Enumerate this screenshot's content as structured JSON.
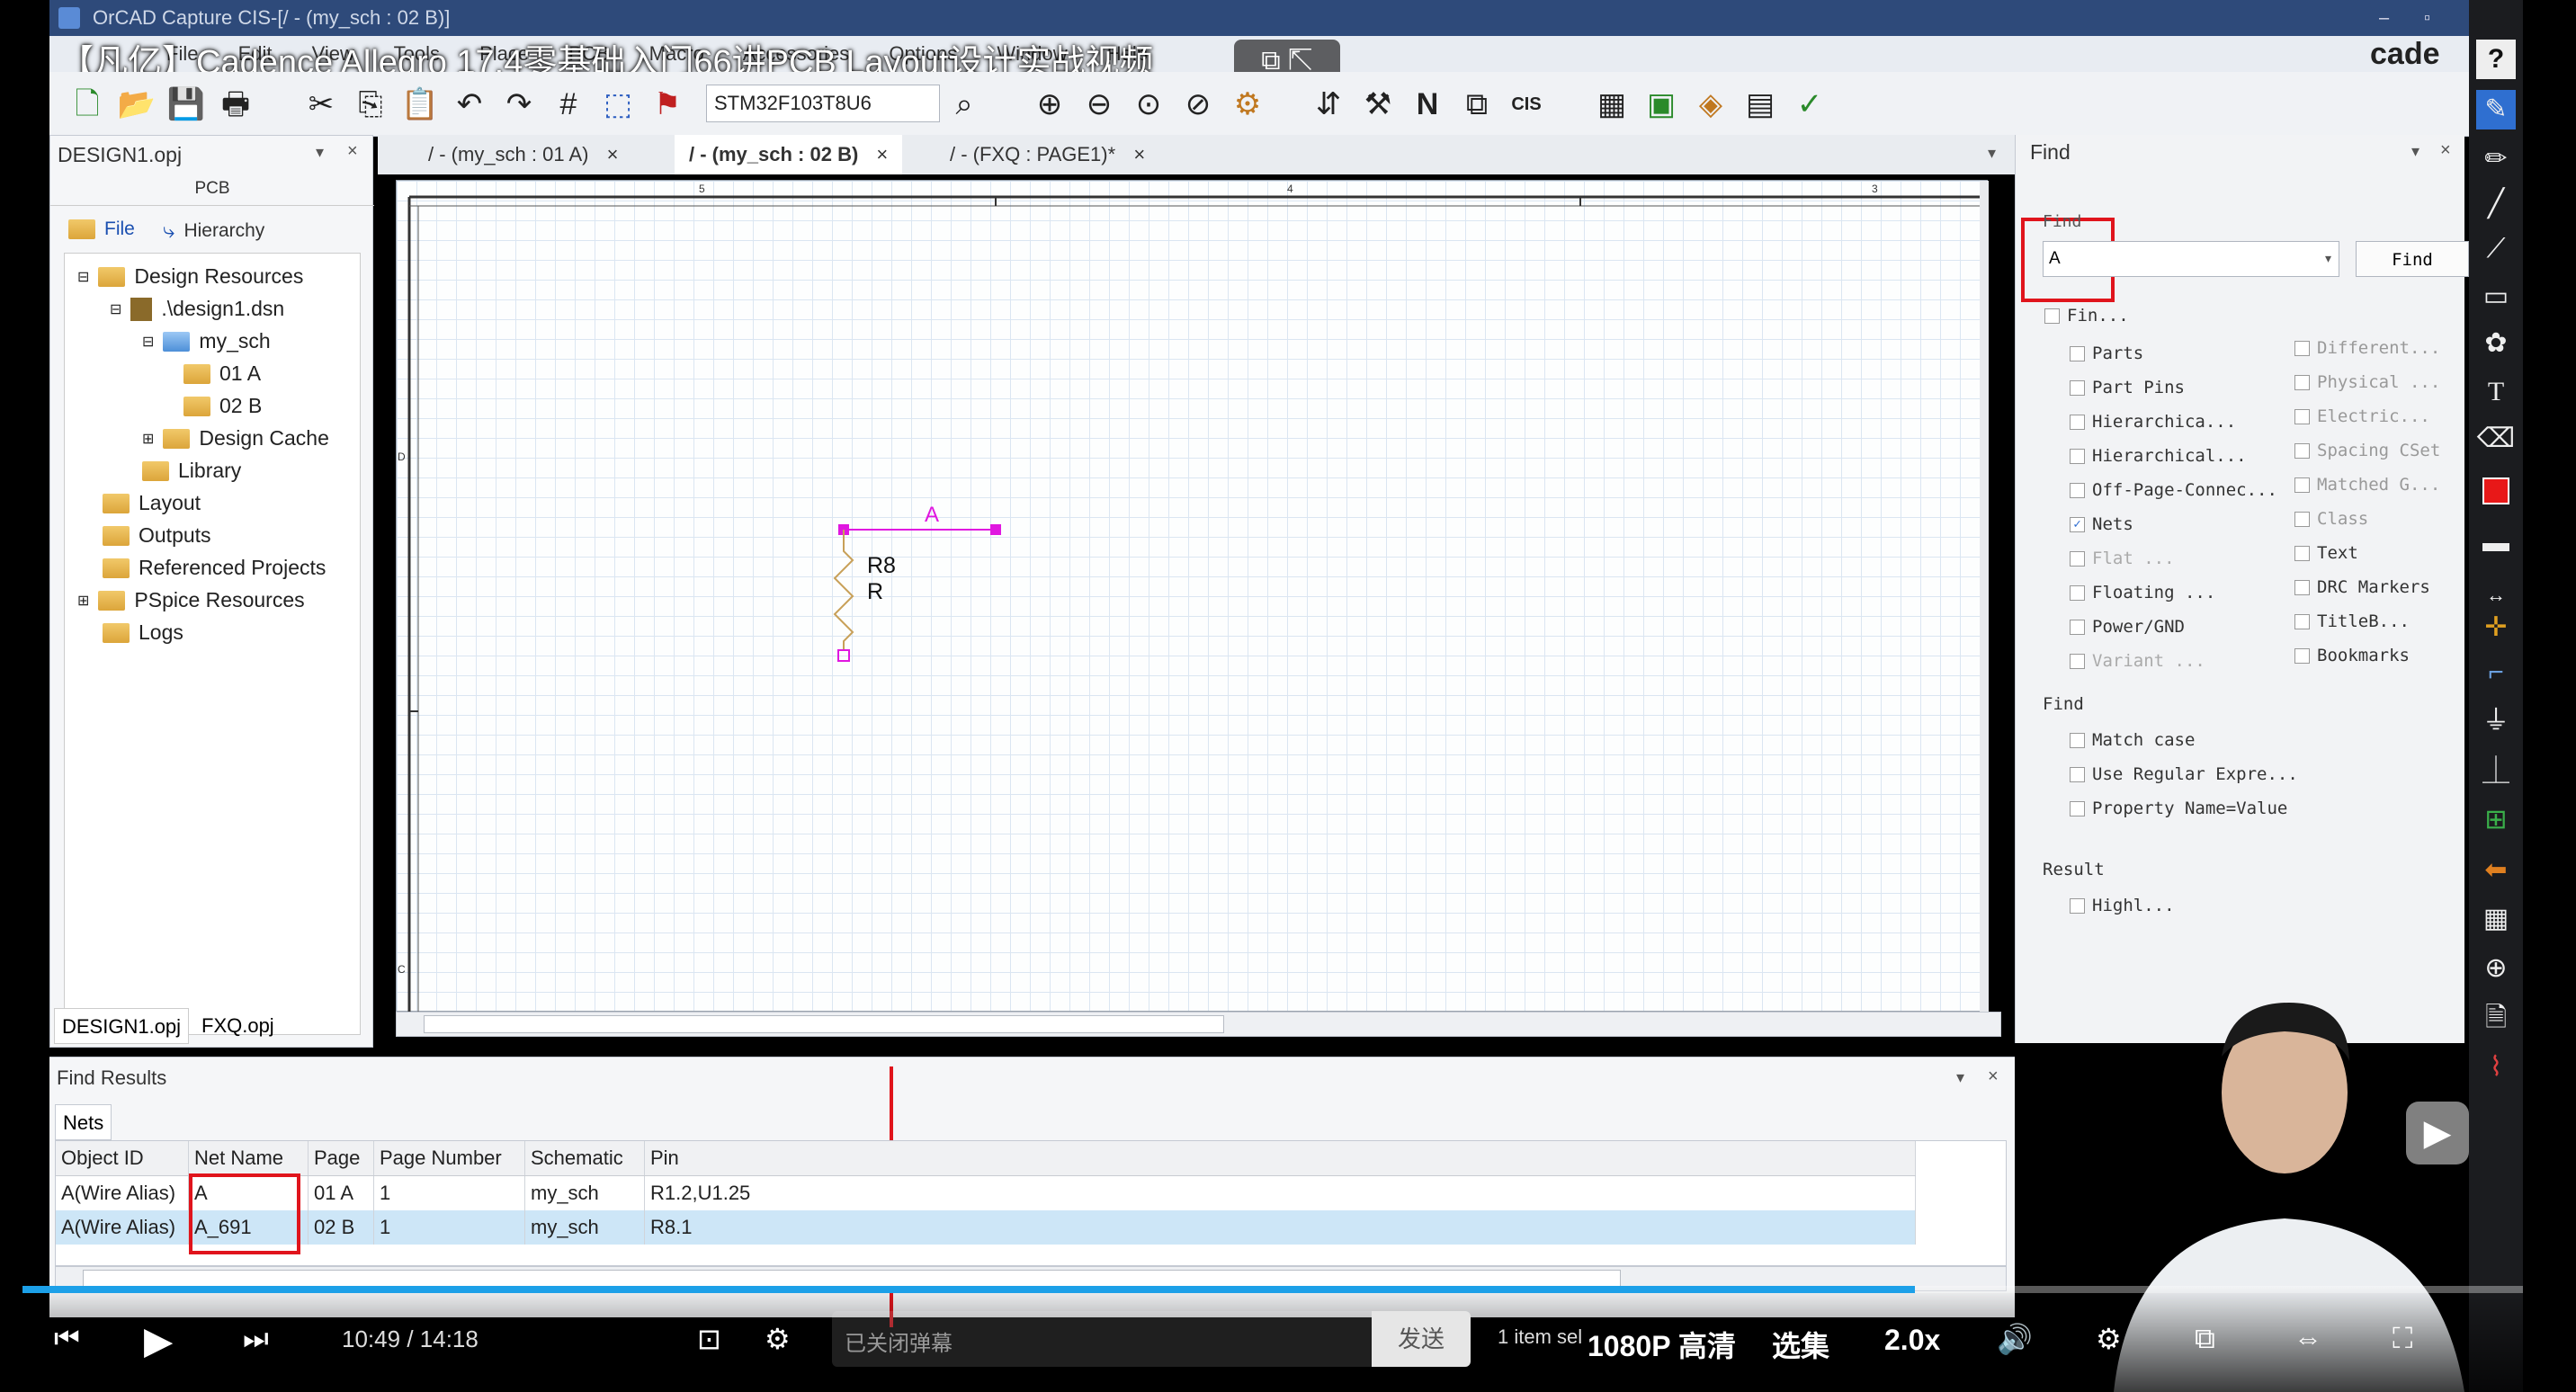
{
  "window": {
    "title": "OrCAD Capture CIS-[/ - (my_sch : 02 B)]",
    "video_title": "【凡亿】Cadence Allegro 17.4零基础入门66讲PCB Layout设计实战视频",
    "menu": [
      "File",
      "Edit",
      "View",
      "Tools",
      "Place",
      "PCB",
      "Macro",
      "Accessories",
      "Options",
      "Window",
      "Help"
    ],
    "part_combo": "STM32F103T8U6",
    "brand": "cade"
  },
  "project_panel": {
    "title": "DESIGN1.opj",
    "section": "PCB",
    "tabs": [
      "File",
      "Hierarchy"
    ],
    "tree": [
      "Design Resources",
      ".\\design1.dsn",
      "my_sch",
      "01 A",
      "02 B",
      "Design Cache",
      "Library",
      "Layout",
      "Outputs",
      "Referenced Projects",
      "PSpice Resources",
      "Logs"
    ],
    "bottom_tabs": [
      "DESIGN1.opj",
      "FXQ.opj"
    ]
  },
  "doc_tabs": [
    "/ - (my_sch : 01 A)",
    "/ - (my_sch : 02 B)",
    "/ - (FXQ : PAGE1)*"
  ],
  "schematic": {
    "ruler_marks": [
      "5",
      "4",
      "3"
    ],
    "side_marks": [
      "D",
      "C"
    ],
    "net_label": "A",
    "part_ref": "R8",
    "part_value": "R"
  },
  "find_panel": {
    "title": "Find",
    "find_label": "Find",
    "find_value": "A",
    "find_button": "Find",
    "find_in_header": "Fin...",
    "left_options": [
      {
        "label": "Parts",
        "checked": false
      },
      {
        "label": "Part Pins",
        "checked": false
      },
      {
        "label": "Hierarchica...",
        "checked": false
      },
      {
        "label": "Hierarchical...",
        "checked": false
      },
      {
        "label": "Off-Page-Connec...",
        "checked": false
      },
      {
        "label": "Nets",
        "checked": true
      },
      {
        "label": "Flat ...",
        "checked": false
      },
      {
        "label": "Floating ...",
        "checked": false
      },
      {
        "label": "Power/GND",
        "checked": false
      },
      {
        "label": "Variant ...",
        "checked": false
      }
    ],
    "right_options": [
      "Different...",
      "Physical ...",
      "Electric...",
      "Spacing CSet",
      "Matched G...",
      "Class",
      "Text",
      "DRC Markers",
      "TitleB...",
      "Bookmarks"
    ],
    "find_section": "Find",
    "find_options": [
      "Match case",
      "Use Regular Expre...",
      "Property Name=Value"
    ],
    "result_section": "Result",
    "result_options": [
      "Highl..."
    ]
  },
  "find_results": {
    "title": "Find Results",
    "tab": "Nets",
    "columns": [
      "Object ID",
      "Net Name",
      "Page",
      "Page Number",
      "Schematic",
      "Pin"
    ],
    "rows": [
      [
        "A(Wire Alias)",
        "A",
        "01 A",
        "1",
        "my_sch",
        "R1.2,U1.25"
      ],
      [
        "A(Wire Alias)",
        "A_691",
        "02 B",
        "1",
        "my_sch",
        "R8.1"
      ]
    ]
  },
  "status": {
    "selection": "1 item sel"
  },
  "player": {
    "time_current": "10:49",
    "time_sep": "/",
    "time_total": "14:18",
    "danmaku_placeholder": "已关闭弹幕",
    "send": "发送",
    "quality": "1080P 高清",
    "episodes": "选集",
    "speed": "2.0x",
    "progress": 0.757
  }
}
